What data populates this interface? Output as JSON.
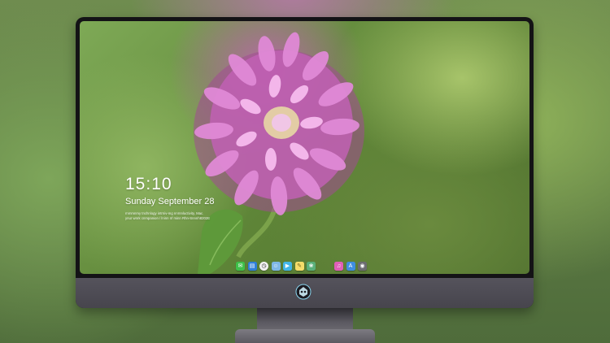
{
  "lock_screen": {
    "time": "15:10",
    "date": "Sunday September 28",
    "notice_line1": "rnmmnmy tnchnlogy intrniv-mg nnrnnluctivity, Mac.",
    "notice_line2": "ynur wnrk cnmpanion / lninn nf minn Rhn-Snnnh8202E"
  },
  "dock": {
    "items": [
      {
        "name": "messages-icon",
        "glyph": "✉",
        "color": "#3fc14a"
      },
      {
        "name": "files-icon",
        "glyph": "▤",
        "color": "#2f7fd9"
      },
      {
        "name": "clock-icon",
        "glyph": "◷",
        "color": "#f2f2f2"
      },
      {
        "name": "finder-icon",
        "glyph": "☺",
        "color": "#7fb8e6"
      },
      {
        "name": "videos-icon",
        "glyph": "▶",
        "color": "#42b6e8"
      },
      {
        "name": "notes-icon",
        "glyph": "✎",
        "color": "#f5dd6a"
      },
      {
        "name": "photos-icon",
        "glyph": "❀",
        "color": "#5ab07a"
      },
      {
        "name": "music-icon",
        "glyph": "♫",
        "color": "#e05fb8"
      },
      {
        "name": "app-store-icon",
        "glyph": "A",
        "color": "#3f8ee0"
      },
      {
        "name": "camera-icon",
        "glyph": "◉",
        "color": "#6c6c70"
      }
    ]
  },
  "colors": {
    "bezel": "#141316",
    "chin": "#4f4d55",
    "lock_text": "#ffffff"
  }
}
